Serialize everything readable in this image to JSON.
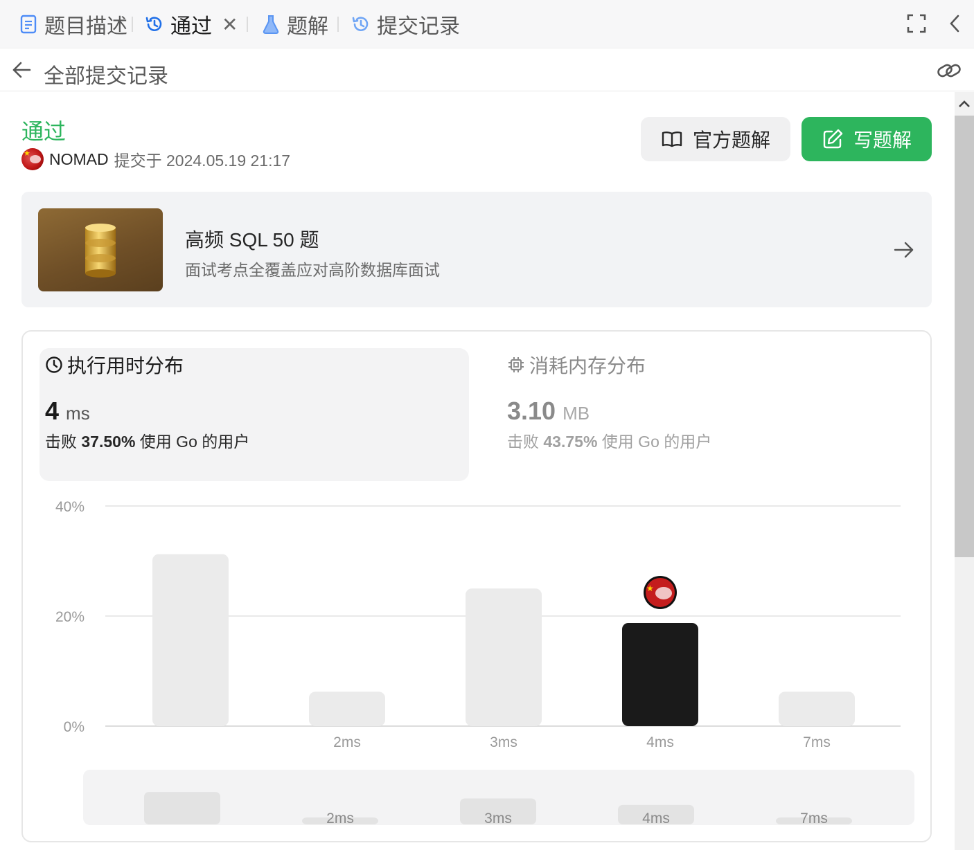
{
  "tabs": [
    {
      "label": "题目描述",
      "icon": "document-icon"
    },
    {
      "label": "通过",
      "icon": "history-icon",
      "active": true,
      "closable": true
    },
    {
      "label": "题解",
      "icon": "flask-icon"
    },
    {
      "label": "提交记录",
      "icon": "history-icon"
    }
  ],
  "subheader": {
    "title": "全部提交记录"
  },
  "submission": {
    "status": "通过",
    "status_color": "#2db55d",
    "user": "NOMAD",
    "submitted_at": "提交于 2024.05.19 21:17",
    "official_solution_label": "官方题解",
    "write_solution_label": "写题解"
  },
  "study_plan": {
    "title": "高频 SQL 50 题",
    "description": "面试考点全覆盖应对高阶数据库面试"
  },
  "runtime": {
    "title": "执行用时分布",
    "value": "4",
    "unit": "ms",
    "beats_prefix": "击败",
    "beats_percent": "37.50%",
    "beats_suffix": "使用 Go 的用户"
  },
  "memory": {
    "title": "消耗内存分布",
    "value": "3.10",
    "unit": "MB",
    "beats_prefix": "击败",
    "beats_percent": "43.75%",
    "beats_suffix": "使用 Go 的用户"
  },
  "chart_data": {
    "type": "bar",
    "y_ticks": [
      "40%",
      "20%",
      "0%"
    ],
    "ylim": [
      0,
      40
    ],
    "categories": [
      "",
      "2ms",
      "3ms",
      "4ms",
      "7ms"
    ],
    "values": [
      31.25,
      6.25,
      25,
      18.75,
      6.25
    ],
    "highlight_index": 3,
    "highlight_color": "#1a1a1a",
    "bar_color": "#ebebeb",
    "grid": true,
    "overview": {
      "categories": [
        "",
        "2ms",
        "3ms",
        "4ms",
        "7ms"
      ],
      "values": [
        31.25,
        6.25,
        25,
        18.75,
        6.25
      ]
    }
  }
}
